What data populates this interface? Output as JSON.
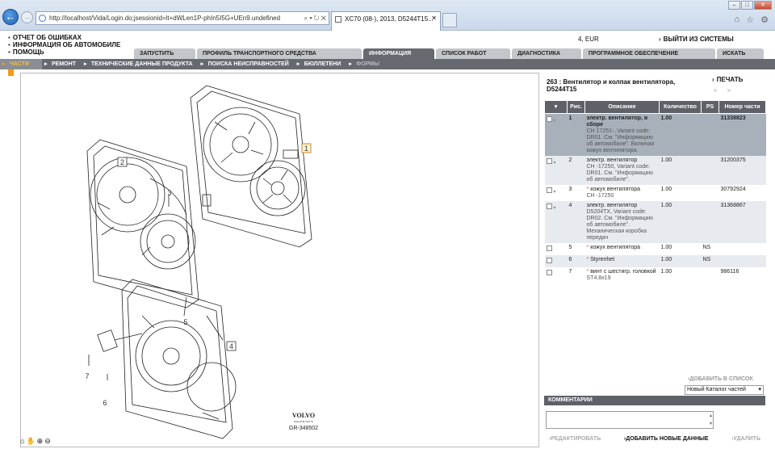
{
  "browser": {
    "url": "http://localhost/Vida/Login.do;jsessionid=lt+dWLen1P-phIn5I5G+UEn9.undefined",
    "url_tools": "⌕ ▾ ↻ ✕",
    "tab_title": "XC70 (08-), 2013, D5244T15...",
    "tab_close": "✕",
    "win_min": "–",
    "win_max": "□",
    "win_close": "✕",
    "icons": [
      "home-icon",
      "star-icon",
      "gear-icon"
    ]
  },
  "header": {
    "links": [
      "ОТЧЕТ ОБ ОШИБКАХ",
      "ИНФОРМАЦИЯ ОБ АВТОМОБИЛЕ",
      "ПОМОЩЬ"
    ],
    "user_info": "4, EUR",
    "logout": "ВЫЙТИ ИЗ СИСТЕМЫ"
  },
  "main_tabs": [
    "ЗАПУСТИТЬ",
    "ПРОФИЛЬ ТРАНСПОРТНОГО СРЕДСТВА",
    "ИНФОРМАЦИЯ",
    "СПИСОК РАБОТ",
    "ДИАГНОСТИКА",
    "ПРОГРАММНОЕ ОБЕСПЕЧЕНИЕ",
    "ИСКАТЬ"
  ],
  "active_main_tab": "ИНФОРМАЦИЯ",
  "sub_nav": [
    "ЧАСТИ",
    "РЕМОНТ",
    "ТЕХНИЧЕСКИЕ ДАННЫЕ ПРОДУКТА",
    "ПОИСКА НЕИСПРАВНОСТЕЙ",
    "БЮЛЛЕТЕНИ",
    "ФОРМЫ"
  ],
  "active_sub_nav": "ЧАСТИ",
  "drawing": {
    "callouts": [
      "1",
      "2",
      "3",
      "4",
      "5",
      "6",
      "7"
    ],
    "brand": "VOLVO",
    "brand_sub": "GENUINE PARTS",
    "figure_id": "GR-348502",
    "tools": [
      "⌂",
      "✋",
      "⊕",
      "⊖"
    ]
  },
  "parts": {
    "title": "263 : Вентилятор и колпак вентилятора, D5244T15",
    "print": "ПЕЧАТЬ",
    "nav": "« »",
    "columns": [
      "",
      "Рис.",
      "Описание",
      "Количество",
      "PS",
      "Номер части"
    ],
    "rows": [
      {
        "fig": "1",
        "desc": "электр. вентилятор, в сборе",
        "sub": "CH 17251-, Variant code: DR01. См. \"Информацию об автомобиле\". Включая кожух вентилятора.",
        "qty": "1.00",
        "ps": "",
        "part": "31338823",
        "star": false,
        "selected": true
      },
      {
        "fig": "2",
        "desc": "электр. вентилятор",
        "sub": "CH -17250, Variant code: DR01. См. \"Информацию об автомобиле\".",
        "qty": "1.00",
        "ps": "",
        "part": "31200375",
        "star": false,
        "selected": false
      },
      {
        "fig": "3",
        "desc": "кожух вентилятора",
        "sub": "CH -17250",
        "qty": "1.00",
        "ps": "",
        "part": "30792924",
        "star": true,
        "selected": false
      },
      {
        "fig": "4",
        "desc": "электр. вентилятор",
        "sub": "D5204TX, Variant code: DR02. См. \"Информацию об автомобиле\". Механическая коробка передач",
        "qty": "1.00",
        "ps": "",
        "part": "31368867",
        "star": false,
        "selected": false
      },
      {
        "fig": "5",
        "desc": "кожух вентилятора",
        "sub": "",
        "qty": "1.00",
        "ps": "NS",
        "part": "",
        "star": true,
        "selected": false
      },
      {
        "fig": "6",
        "desc": "Styrenhet",
        "sub": "",
        "qty": "1.00",
        "ps": "NS",
        "part": "",
        "star": true,
        "selected": false
      },
      {
        "fig": "7",
        "desc": "винт с шестигр. головкой",
        "sub": "ST4.8x19",
        "qty": "1.00",
        "ps": "",
        "part": "986116",
        "star": true,
        "selected": false
      }
    ],
    "add_to_list": "ДОБАВИТЬ В СПИСОК",
    "catalog_select": "Новый Каталог частей"
  },
  "comments": {
    "header": "КОММЕНТАРИИ",
    "edit": "РЕДАКТИРОВАТЬ",
    "add": "ДОБАВИТЬ НОВЫЕ ДАННЫЕ",
    "delete": "УДАЛИТЬ"
  }
}
